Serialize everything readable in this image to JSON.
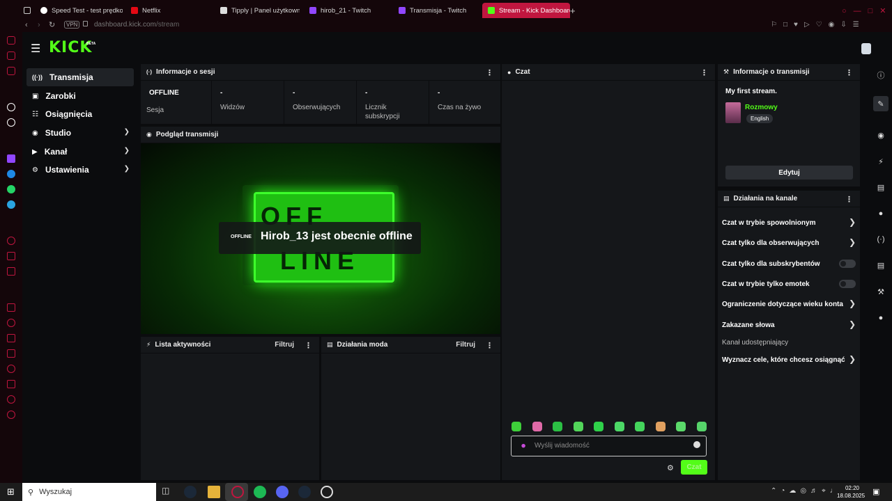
{
  "browser": {
    "tabs": [
      {
        "label": "Speed Test - test prędkos",
        "color": "#ffffff"
      },
      {
        "label": "Netflix",
        "color": "#e50914"
      },
      {
        "label": "Tipply | Panel użytkowni",
        "color": "#ffffff"
      },
      {
        "label": "hirob_21 - Twitch",
        "color": "#9146ff"
      },
      {
        "label": "Transmisja - Twitch",
        "color": "#9146ff"
      },
      {
        "label": "Stream - Kick Dashboard",
        "color": "#53fc18"
      }
    ],
    "vpn": "VPN",
    "url_domain": "dashboard.kick.com",
    "url_path": "/stream",
    "new_tab": "+"
  },
  "app": {
    "logo": "KICK",
    "logo_badge": "BETA",
    "accent": "#53fc18"
  },
  "nav": {
    "items": [
      {
        "label": "Transmisja",
        "icon": "broadcast-icon"
      },
      {
        "label": "Zarobki",
        "icon": "wallet-icon"
      },
      {
        "label": "Osiągnięcia",
        "icon": "trophy-icon"
      },
      {
        "label": "Studio",
        "icon": "camera-icon"
      },
      {
        "label": "Kanał",
        "icon": "play-icon"
      },
      {
        "label": "Ustawienia",
        "icon": "gear-icon"
      }
    ]
  },
  "session": {
    "title": "Informacje o sesji",
    "stats": [
      {
        "value": "OFFLINE",
        "label": "Sesja"
      },
      {
        "value": "-",
        "label": "Widzów"
      },
      {
        "value": "-",
        "label": "Obserwujących"
      },
      {
        "value": "-",
        "label": "Licznik subskrypcji"
      },
      {
        "value": "-",
        "label": "Czas na żywo"
      }
    ]
  },
  "preview": {
    "title": "Podgląd transmisji",
    "badge": "OFFLINE",
    "message": "Hirob_13 jest obecnie offline",
    "sign_top": "OFF",
    "sign_bottom": "LINE"
  },
  "activity": {
    "title": "Lista aktywności",
    "filter": "Filtruj"
  },
  "modactions": {
    "title": "Działania moda",
    "filter": "Filtruj"
  },
  "chat": {
    "title": "Czat",
    "placeholder": "Wyślij wiadomość",
    "send": "Czat",
    "emote_count": 10
  },
  "stream_info": {
    "title": "Informacje o transmisji",
    "stream_title": "My first stream.",
    "category": "Rozmowy",
    "language": "English",
    "edit": "Edytuj"
  },
  "channel_actions": {
    "title": "Działania na kanale",
    "items": [
      {
        "label": "Czat w trybie spowolnionym",
        "kind": "arrow"
      },
      {
        "label": "Czat tylko dla obserwujących",
        "kind": "arrow"
      },
      {
        "label": "Czat tylko dla subskrybentów",
        "kind": "toggle"
      },
      {
        "label": "Czat w trybie tylko emotek",
        "kind": "toggle"
      },
      {
        "label": "Ograniczenie dotyczące wieku konta",
        "kind": "arrow"
      },
      {
        "label": "Zakazane słowa",
        "kind": "arrow"
      },
      {
        "label": "Kanał udostępniający",
        "kind": "muted"
      },
      {
        "label": "Wyznacz cele, które chcesz osiągnąć",
        "kind": "arrow"
      }
    ]
  },
  "taskbar": {
    "search": "Wyszukaj",
    "time": "02:20",
    "date": "18.08.2025"
  }
}
